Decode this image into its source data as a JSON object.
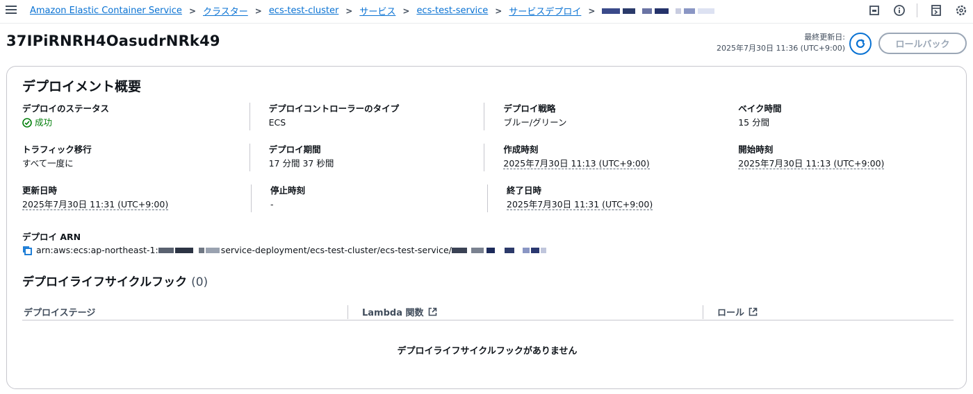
{
  "breadcrumb": {
    "items": [
      {
        "label": "Amazon Elastic Container Service"
      },
      {
        "label": "クラスター"
      },
      {
        "label": "ecs-test-cluster"
      },
      {
        "label": "サービス"
      },
      {
        "label": "ecs-test-service"
      },
      {
        "label": "サービスデプロイ"
      }
    ]
  },
  "header": {
    "title": "37IPiRNRH4OasudrNRk49",
    "updated_label": "最終更新日:",
    "updated_value": "2025年7月30日 11:36 (UTC+9:00)",
    "rollback_label": "ロールバック"
  },
  "overview": {
    "title": "デプロイメント概要",
    "rows": [
      [
        {
          "label": "デプロイのステータス",
          "value": "成功"
        },
        {
          "label": "デプロイコントローラーのタイプ",
          "value": "ECS"
        },
        {
          "label": "デプロイ戦略",
          "value": "ブルー/グリーン"
        },
        {
          "label": "ベイク時間",
          "value": "15 分間"
        }
      ],
      [
        {
          "label": "トラフィック移行",
          "value": "すべて一度に"
        },
        {
          "label": "デプロイ期間",
          "value": "17 分間 37 秒間"
        },
        {
          "label": "作成時刻",
          "value": "2025年7月30日 11:13 (UTC+9:00)"
        },
        {
          "label": "開始時刻",
          "value": "2025年7月30日 11:13 (UTC+9:00)"
        }
      ],
      [
        {
          "label": "更新日時",
          "value": "2025年7月30日 11:31 (UTC+9:00)"
        },
        {
          "label": "停止時刻",
          "value": "-"
        },
        {
          "label": "終了日時",
          "value": "2025年7月30日 11:31 (UTC+9:00)"
        }
      ]
    ],
    "arn_label": "デプロイ ARN",
    "arn_prefix": "arn:aws:ecs:ap-northeast-1:",
    "arn_middle": "service-deployment/ecs-test-cluster/ecs-test-service/"
  },
  "hooks": {
    "title": "デプロイライフサイクルフック",
    "count": "(0)",
    "columns": [
      "デプロイステージ",
      "Lambda 関数",
      "ロール"
    ],
    "empty": "デプロイライフサイクルフックがありません"
  },
  "colors": {
    "link": "#0972d3",
    "success": "#037f0c",
    "disabled": "#9ba7b6"
  }
}
